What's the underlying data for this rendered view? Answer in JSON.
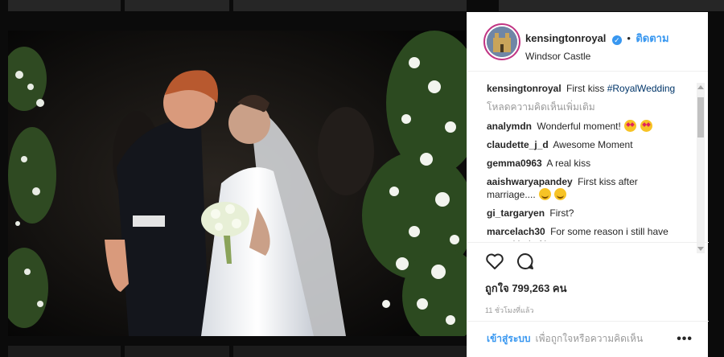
{
  "post": {
    "username": "kensingtonroyal",
    "verified_badge_icon": "verified-check-icon",
    "dot": "•",
    "follow_label": "ติดตาม",
    "location": "Windsor Castle",
    "caption": {
      "user": "kensingtonroyal",
      "text": "First kiss",
      "hashtag": "#RoyalWedding"
    },
    "load_more": "โหลดความคิดเห็นเพิ่มเติม",
    "comments": [
      {
        "user": "analymdn",
        "text": "Wonderful moment!",
        "emojis": [
          "heart-eyes-emoji",
          "heart-eyes-emoji"
        ]
      },
      {
        "user": "claudette_j_d",
        "text": "Awesome Moment"
      },
      {
        "user": "gemma0963",
        "text": "A real kiss"
      },
      {
        "user": "aaishwaryapandey",
        "text": "First kiss after marriage....",
        "emojis": [
          "smile-emoji",
          "smile-emoji"
        ]
      },
      {
        "user": "gi_targaryen",
        "text": "First?"
      },
      {
        "user": "marcelach30",
        "text": "For some reason i still have some kind of hope"
      }
    ],
    "like_count_label": "ถูกใจ 799,263 คน",
    "timestamp": "11 ชั่วโมงที่แล้ว",
    "login_link": "เข้าสู่ระบบ",
    "login_text": "เพื่อถูกใจหรือความคิดเห็น",
    "more_label": "•••",
    "icons": {
      "like": "heart-outline-icon",
      "comment": "speech-bubble-icon",
      "more": "ellipsis-icon"
    },
    "colors": {
      "link_blue": "#3897f0",
      "hashtag": "#003569",
      "muted": "#999999"
    }
  }
}
